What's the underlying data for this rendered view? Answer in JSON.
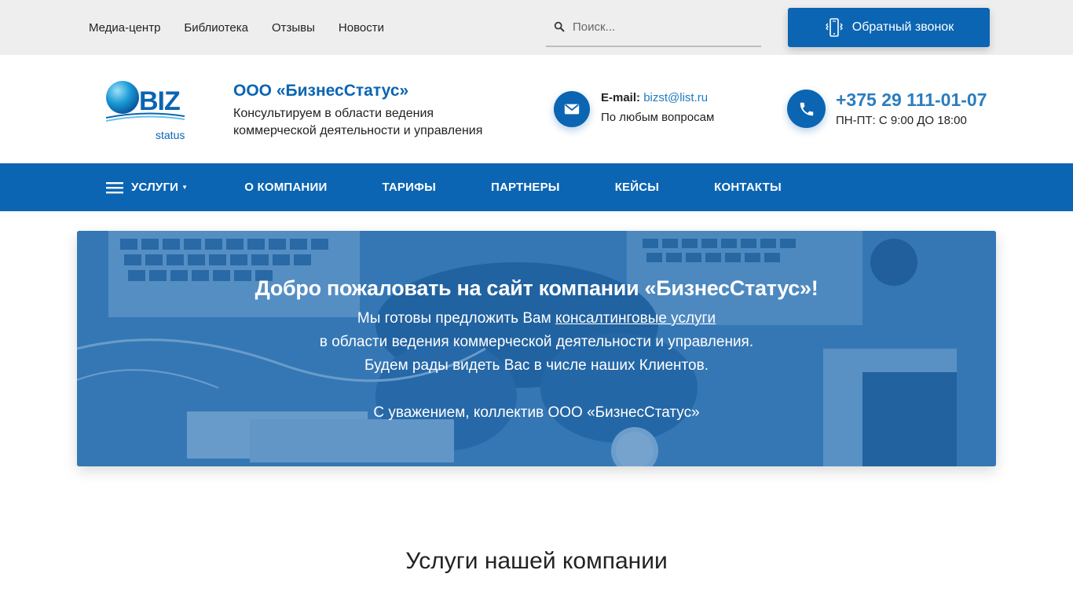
{
  "topbar": {
    "links": [
      "Медиа-центр",
      "Библиотека",
      "Отзывы",
      "Новости"
    ],
    "search_placeholder": "Поиск...",
    "callback_label": "Обратный звонок"
  },
  "header": {
    "logo_text": "BIZ",
    "logo_sub": "status",
    "company_name": "ООО «БизнесСтатус»",
    "company_desc": "Консультируем в области ведения коммерческой деятельности и управления",
    "email_label": "E-mail:",
    "email": "bizst@list.ru",
    "email_sub": "По любым вопросам",
    "phone": "+375 29 111-01-07",
    "phone_hours": "ПН-ПТ: С 9:00 ДО 18:00"
  },
  "nav": {
    "services": "Услуги",
    "items": [
      "О компании",
      "Тарифы",
      "Партнеры",
      "Кейсы",
      "Контакты"
    ]
  },
  "hero": {
    "title": "Добро пожаловать на сайт компании «БизнесСтатус»!",
    "line1_pre": "Мы готовы предложить Вам ",
    "line1_link": "консалтинговые услуги",
    "line2": "в области ведения коммерческой деятельности и управления.",
    "line3": "Будем рады видеть Вас в числе наших Клиентов.",
    "sign": "С уважением, коллектив ООО «БизнесСтатус»"
  },
  "section": {
    "title": "Услуги нашей компании"
  },
  "colors": {
    "brand": "#0b65b2",
    "topbar_bg": "#eeeeee",
    "link": "#1e7bc1"
  }
}
